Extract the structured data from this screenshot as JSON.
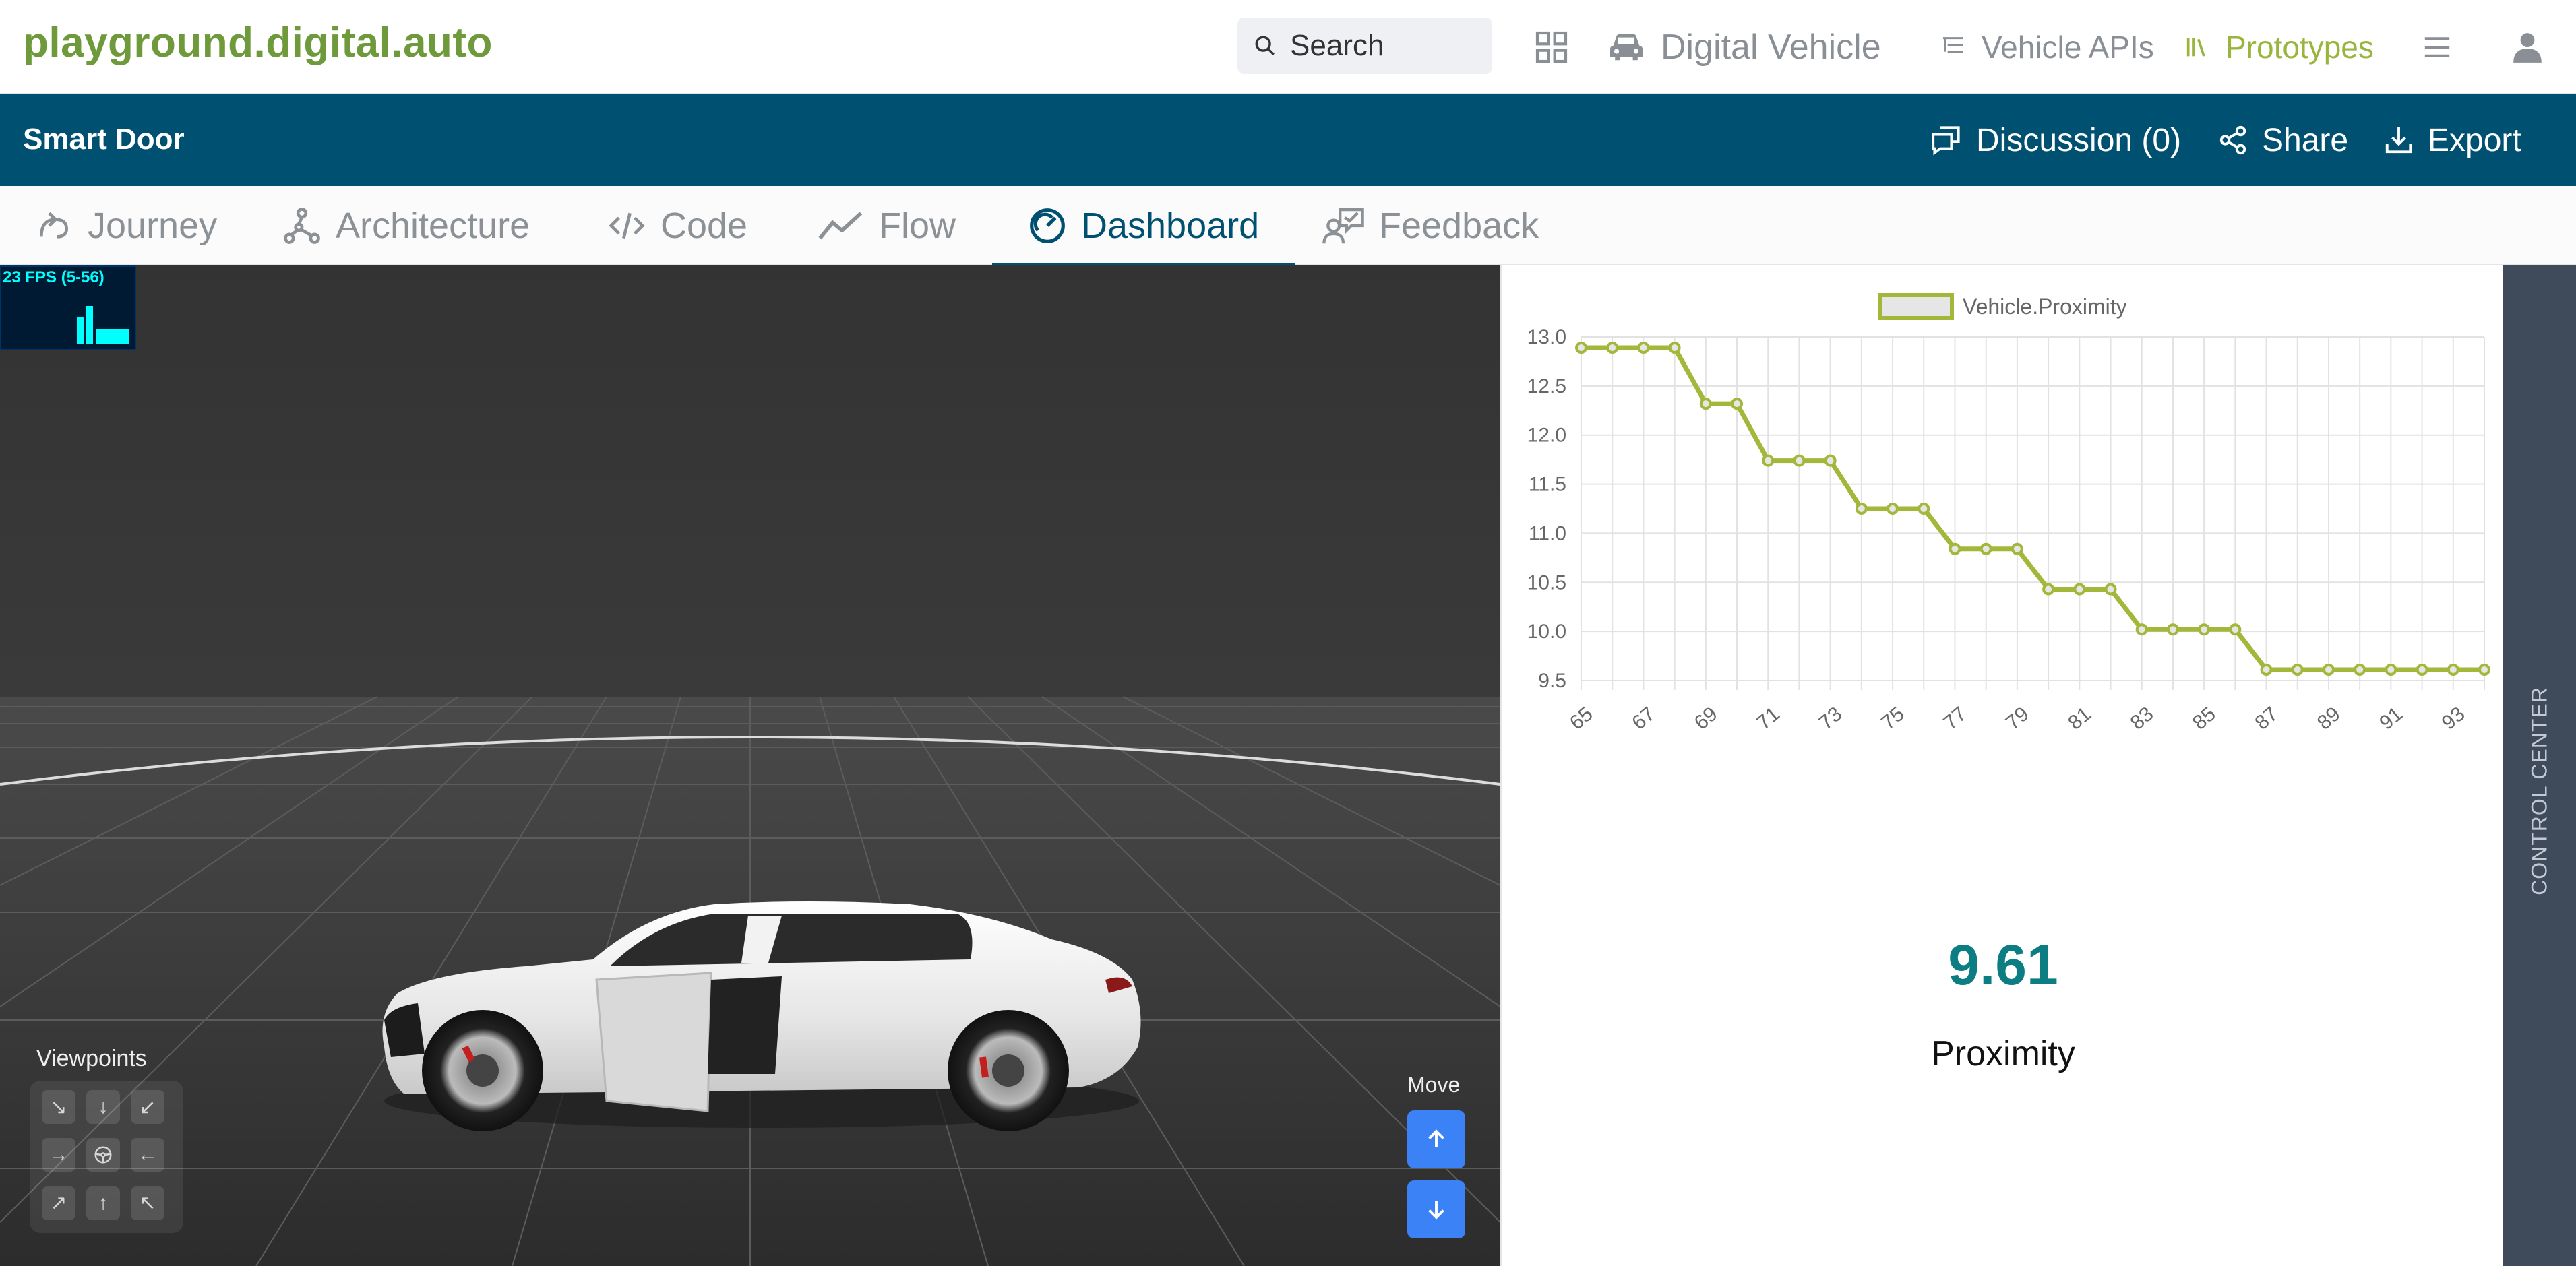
{
  "app": {
    "logo": "playground.digital.auto"
  },
  "nav": {
    "search_label": "Search",
    "digital_vehicle": "Digital Vehicle",
    "vehicle_apis": "Vehicle APIs",
    "prototypes": "Prototypes"
  },
  "header": {
    "title": "Smart Door",
    "discussion": "Discussion (0)",
    "share": "Share",
    "export": "Export"
  },
  "tabs": [
    {
      "label": "Journey"
    },
    {
      "label": "Architecture"
    },
    {
      "label": "Code"
    },
    {
      "label": "Flow"
    },
    {
      "label": "Dashboard",
      "active": true
    },
    {
      "label": "Feedback"
    }
  ],
  "viewport": {
    "fps": "23 FPS (5-56)",
    "viewpoints_label": "Viewpoints",
    "move_label": "Move"
  },
  "widget": {
    "value": "9.61",
    "label": "Proximity"
  },
  "control_center": "CONTROL CENTER",
  "colors": {
    "brand_blue": "#005072",
    "accent_green": "#9ab53d",
    "value_teal": "#0c7d82",
    "move_blue": "#3b82f6"
  },
  "chart_data": {
    "type": "line",
    "series": [
      {
        "name": "Vehicle.Proximity",
        "x": [
          65,
          66,
          67,
          68,
          69,
          70,
          71,
          72,
          73,
          74,
          75,
          76,
          77,
          78,
          79,
          80,
          81,
          82,
          83,
          84,
          85,
          86,
          87,
          88,
          89,
          90,
          91,
          92,
          93,
          94
        ],
        "values": [
          12.89,
          12.89,
          12.89,
          12.89,
          12.32,
          12.32,
          11.74,
          11.74,
          11.74,
          11.25,
          11.25,
          11.25,
          10.84,
          10.84,
          10.84,
          10.43,
          10.43,
          10.43,
          10.02,
          10.02,
          10.02,
          10.02,
          9.61,
          9.61,
          9.61,
          9.61,
          9.61,
          9.61,
          9.61,
          9.61
        ]
      }
    ],
    "x_ticks": [
      "65",
      "67",
      "69",
      "71",
      "73",
      "75",
      "77",
      "79",
      "81",
      "83",
      "85",
      "87",
      "89",
      "91",
      "93"
    ],
    "y_ticks": [
      "13.0",
      "12.5",
      "12.0",
      "11.5",
      "11.0",
      "10.5",
      "10.0",
      "9.5"
    ],
    "ylim": [
      9.5,
      13.0
    ],
    "grid": true,
    "legend": "top"
  }
}
